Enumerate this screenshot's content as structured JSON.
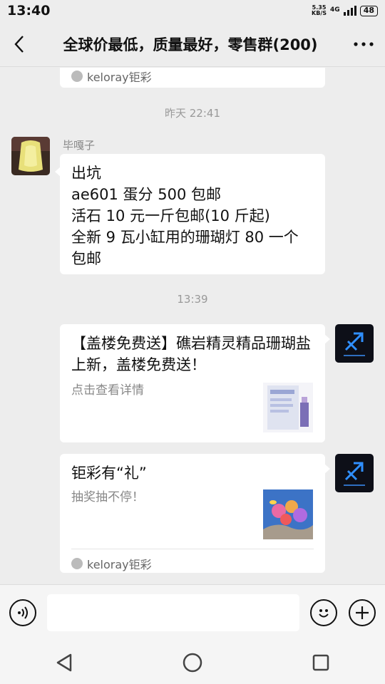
{
  "statusbar": {
    "time": "13:40",
    "net_speed_value": "5.35",
    "net_speed_unit": "KB/S",
    "network": "4G",
    "battery": "48"
  },
  "header": {
    "title": "全球价最低，质量最好，零售群(200)"
  },
  "messages": {
    "top_card_source": "keloray钜彩",
    "time1": "昨天 22:41",
    "msg1": {
      "sender": "毕嘎子",
      "text": "出坑\nae601 蛋分 500 包邮\n活石 10 元一斤包邮(10 斤起)\n全新 9 瓦小缸用的珊瑚灯 80 一个\n包邮"
    },
    "time2": "13:39",
    "link1": {
      "title": "【盖楼免费送】礁岩精灵精品珊瑚盐上新，盖楼免费送！",
      "desc": "点击查看详情"
    },
    "link2": {
      "title": "钜彩有“礼”",
      "desc": "抽奖抽不停！",
      "source": "keloray钜彩"
    }
  },
  "colors": {
    "background": "#ededed",
    "bubble": "#ffffff",
    "accent_blue": "#0b5fae"
  }
}
